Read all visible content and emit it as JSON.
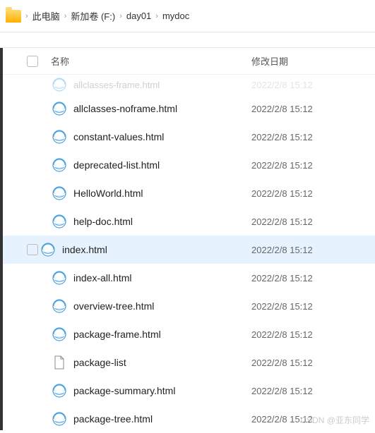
{
  "breadcrumb": {
    "items": [
      "此电脑",
      "新加坡 (F:)",
      "day01",
      "mydoc"
    ],
    "crumb1": "此电脑",
    "crumb2": "新加卷 (F:)",
    "crumb3": "day01",
    "crumb4": "mydoc"
  },
  "headers": {
    "name": "名称",
    "date": "修改日期"
  },
  "files": [
    {
      "name": "allclasses-frame.html",
      "date": "2022/2/8 15:12",
      "type": "html",
      "faded": true
    },
    {
      "name": "allclasses-noframe.html",
      "date": "2022/2/8 15:12",
      "type": "html"
    },
    {
      "name": "constant-values.html",
      "date": "2022/2/8 15:12",
      "type": "html"
    },
    {
      "name": "deprecated-list.html",
      "date": "2022/2/8 15:12",
      "type": "html"
    },
    {
      "name": "HelloWorld.html",
      "date": "2022/2/8 15:12",
      "type": "html"
    },
    {
      "name": "help-doc.html",
      "date": "2022/2/8 15:12",
      "type": "html"
    },
    {
      "name": "index.html",
      "date": "2022/2/8 15:12",
      "type": "html",
      "selected": true
    },
    {
      "name": "index-all.html",
      "date": "2022/2/8 15:12",
      "type": "html"
    },
    {
      "name": "overview-tree.html",
      "date": "2022/2/8 15:12",
      "type": "html"
    },
    {
      "name": "package-frame.html",
      "date": "2022/2/8 15:12",
      "type": "html"
    },
    {
      "name": "package-list",
      "date": "2022/2/8 15:12",
      "type": "file"
    },
    {
      "name": "package-summary.html",
      "date": "2022/2/8 15:12",
      "type": "html"
    },
    {
      "name": "package-tree.html",
      "date": "2022/2/8 15:12",
      "type": "html"
    }
  ],
  "watermark": "CSDN @亚东同学"
}
